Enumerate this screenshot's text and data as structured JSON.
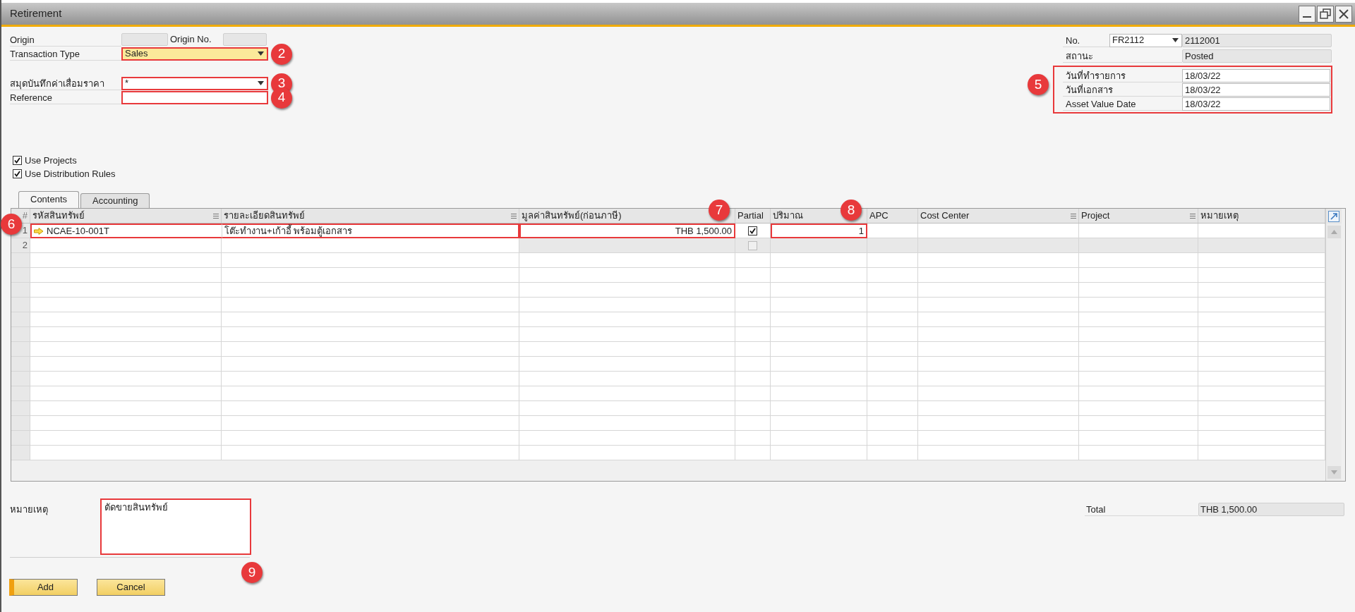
{
  "window": {
    "title": "Retirement"
  },
  "header_left": [
    [
      {
        "kind": "origin",
        "label": "Origin",
        "label_2": "Origin No."
      },
      {
        "kind": "dropdown",
        "label": "Transaction Type",
        "value": "Sales",
        "focused": true,
        "callout": "2"
      }
    ],
    [
      {
        "kind": "dropdown",
        "label": "สมุดบันทึกค่าเสื่อมราคา",
        "value": "*",
        "focused": false,
        "callout": "3"
      },
      {
        "kind": "text",
        "label": "Reference",
        "focused": false,
        "callout": "4"
      }
    ]
  ],
  "document": {
    "label": "No.",
    "series": "FR2112",
    "number": "2112001"
  },
  "status": {
    "label": "สถานะ",
    "value": "Posted"
  },
  "dates": {
    "callout": "5",
    "rows": [
      {
        "label": "วันที่ทำรายการ",
        "value": "18/03/22"
      },
      {
        "label": "วันที่เอกสาร",
        "value": "18/03/22"
      },
      {
        "label": "Asset Value Date",
        "value": "18/03/22"
      }
    ]
  },
  "options": [
    {
      "label": "Use Projects",
      "checked": true
    },
    {
      "label": "Use Distribution Rules",
      "checked": true
    }
  ],
  "tabs": [
    {
      "label": "Contents",
      "selected": true
    },
    {
      "label": "Accounting",
      "selected": false
    }
  ],
  "table": {
    "columns": [
      {
        "label": "#",
        "menu": false
      },
      {
        "label": "รหัสสินทรัพย์",
        "menu": true
      },
      {
        "label": "รายละเอียดสินทรัพย์",
        "menu": true
      },
      {
        "label": "มูลค่าสินทรัพย์(ก่อนภาษี)",
        "menu": false
      },
      {
        "label": "Partial",
        "menu": false
      },
      {
        "label": "ปริมาณ",
        "menu": false
      },
      {
        "label": "APC",
        "menu": false
      },
      {
        "label": "Cost Center",
        "menu": true
      },
      {
        "label": "Project",
        "menu": true
      },
      {
        "label": "หมายเหตุ",
        "menu": false
      }
    ],
    "rows": [
      {
        "kind": "item",
        "number": "1",
        "code": "NCAE-10-001T",
        "description": "โต๊ะทำงาน+เก้าอี้ พร้อมตู้เอกสาร",
        "value": "THB 1,500.00",
        "partial": true,
        "quantity": "1",
        "callout_item": "6",
        "callout_value": "7",
        "callout_quantity": "8"
      },
      {
        "kind": "new",
        "number": "2",
        "partial": false
      }
    ]
  },
  "remarks": {
    "label": "หมายเหตุ",
    "value": "ตัดขายสินทรัพย์",
    "callout": "9"
  },
  "total": {
    "label": "Total",
    "value": "THB 1,500.00"
  },
  "buttons": [
    {
      "label": "Add",
      "primary": true
    },
    {
      "label": "Cancel",
      "primary": false
    }
  ]
}
